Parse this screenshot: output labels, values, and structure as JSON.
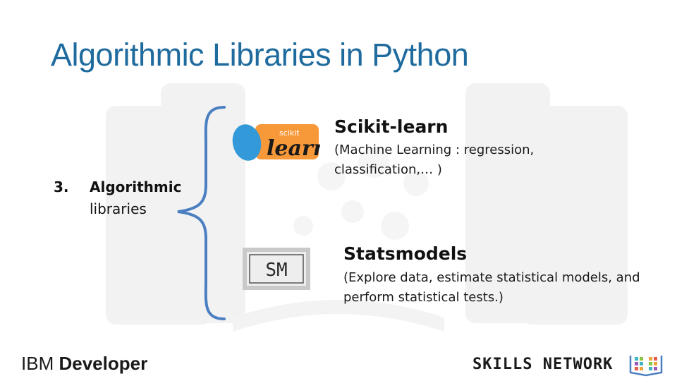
{
  "slide": {
    "title": "Algorithmic Libraries in Python",
    "point": {
      "number": "3.",
      "heading": "Algorithmic",
      "subheading": "libraries"
    },
    "libraries": [
      {
        "name": "Scikit-learn",
        "description": "(Machine Learning : regression, classification,… )",
        "logo_text_small": "scikit",
        "logo_text_large": "learn",
        "logo_colors": {
          "circle": "#3499d8",
          "tile": "#f89939",
          "text": "#1a1a1a"
        }
      },
      {
        "name": "Statsmodels",
        "description": "(Explore data, estimate statistical models, and perform statistical tests.)",
        "logo_text": "SM"
      }
    ]
  },
  "footer": {
    "ibm_prefix": "IBM",
    "ibm_word": "Developer",
    "skills_network": "SKILLS NETWORK",
    "skills_icon": "book-grid-icon"
  },
  "colors": {
    "title": "#1f6b9e",
    "brace": "#4b7fc1",
    "text": "#111111",
    "watermark": "#f1f1f1"
  }
}
